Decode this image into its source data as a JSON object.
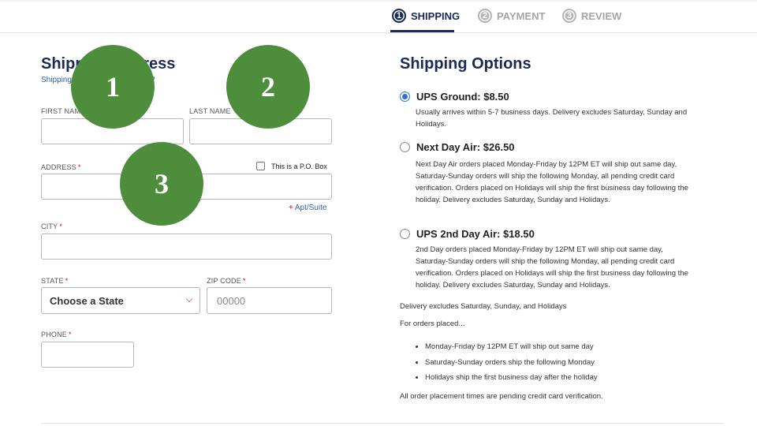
{
  "steps": [
    {
      "num": "1",
      "label": "SHIPPING"
    },
    {
      "num": "2",
      "label": "PAYMENT"
    },
    {
      "num": "3",
      "label": "REVIEW"
    }
  ],
  "address": {
    "title": "Shipping Address",
    "sublink": "Shipping to a business address?",
    "first_name_label": "FIRST NAME",
    "last_name_label": "LAST NAME",
    "address_label": "ADDRESS",
    "po_box_label": "This is a P.O. Box",
    "apt_link": "Apt/Suite",
    "city_label": "CITY",
    "state_label": "STATE",
    "state_value": "Choose a State",
    "zip_label": "ZIP CODE",
    "zip_placeholder": "00000",
    "phone_label": "PHONE",
    "required_mark": "*"
  },
  "shipping": {
    "title": "Shipping Options",
    "options": [
      {
        "title": "UPS Ground: $8.50",
        "desc": "Usually arrives within 5-7 business days. Delivery excludes Saturday, Sunday and Holidays.",
        "checked": true
      },
      {
        "title": "Next Day Air: $26.50",
        "desc": "Next Day Air orders placed Monday-Friday by 12PM ET will ship out same day, Saturday-Sunday orders will ship the following Monday, all pending credit card verification. Orders placed on Holidays will ship the first business day following the holiday. Delivery excludes Saturday, Sunday and Holidays.",
        "checked": false
      },
      {
        "title": "UPS 2nd Day Air: $18.50",
        "desc": "2nd Day orders placed Monday-Friday by 12PM ET will ship out same day, Saturday-Sunday orders will ship the following Monday, all pending credit card verification. Orders placed on Holidays will ship the first business day following the holiday. Delivery excludes Saturday, Sunday and Holidays.",
        "checked": false
      }
    ],
    "delivery_note": "Delivery excludes Saturday, Sunday, and Holidays",
    "orders_intro": "For orders placed...",
    "bullets": [
      "Monday-Friday by 12PM ET will ship out same day",
      "Saturday-Sunday orders ship the following Monday",
      "Holidays ship the first business day after the holiday"
    ],
    "footer_note": "All order placement times are pending credit card verification."
  },
  "markers": [
    "1",
    "2",
    "3"
  ],
  "colors": {
    "navy": "#1b2a55",
    "link": "#2f5fa8",
    "required": "#d0021b",
    "radio": "#2f6fd6",
    "marker": "#4d8d3b"
  }
}
